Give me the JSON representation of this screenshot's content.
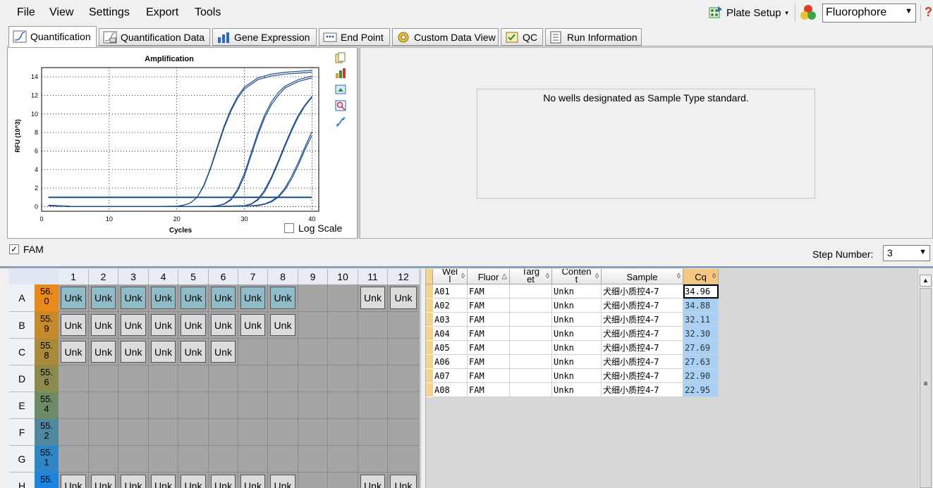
{
  "menu": [
    "File",
    "View",
    "Settings",
    "Export",
    "Tools"
  ],
  "toolbar": {
    "plate_setup": "Plate Setup",
    "fluorophore": "Fluorophore",
    "help": "?"
  },
  "tabs": [
    "Quantification",
    "Quantification Data",
    "Gene Expression",
    "End Point",
    "Custom Data View",
    "QC",
    "Run Information"
  ],
  "chart": {
    "log_scale_label": "Log Scale"
  },
  "chart_data": {
    "type": "line",
    "title": "Amplification",
    "xlabel": "Cycles",
    "ylabel": "RFU (10^3)",
    "xlim": [
      0,
      41
    ],
    "ylim": [
      -0.5,
      15
    ],
    "xticks": [
      0,
      10,
      20,
      30,
      40
    ],
    "yticks": [
      0,
      2,
      4,
      6,
      8,
      10,
      12,
      14
    ],
    "grid": true,
    "threshold": 1.0,
    "series": [
      {
        "x": [
          1,
          5,
          10,
          15,
          20,
          21,
          22,
          23,
          24,
          25,
          26,
          27,
          28,
          29,
          30,
          32,
          34,
          36,
          38,
          40
        ],
        "values": [
          0.1,
          0.0,
          0.0,
          0.0,
          0.05,
          0.15,
          0.4,
          1.0,
          2.3,
          4.2,
          6.5,
          8.7,
          10.5,
          11.9,
          12.9,
          13.9,
          14.3,
          14.5,
          14.6,
          14.7
        ]
      },
      {
        "x": [
          1,
          5,
          10,
          15,
          20,
          21,
          22,
          23,
          24,
          25,
          26,
          27,
          28,
          29,
          30,
          32,
          34,
          36,
          38,
          40
        ],
        "values": [
          0.15,
          0.0,
          0.0,
          0.0,
          0.05,
          0.15,
          0.4,
          1.0,
          2.2,
          4.1,
          6.3,
          8.5,
          10.3,
          11.7,
          12.7,
          13.7,
          14.1,
          14.3,
          14.4,
          14.5
        ]
      },
      {
        "x": [
          1,
          5,
          10,
          15,
          20,
          25,
          26,
          27,
          28,
          29,
          30,
          31,
          32,
          33,
          34,
          35,
          36,
          38,
          40
        ],
        "values": [
          0.1,
          0.0,
          0.0,
          0.0,
          0.0,
          0.05,
          0.1,
          0.3,
          0.8,
          1.9,
          3.6,
          5.8,
          8.0,
          9.9,
          11.3,
          12.3,
          13.0,
          13.7,
          14.1
        ]
      },
      {
        "x": [
          1,
          5,
          10,
          15,
          20,
          25,
          26,
          27,
          28,
          29,
          30,
          31,
          32,
          33,
          34,
          35,
          36,
          38,
          40
        ],
        "values": [
          0.1,
          0.0,
          0.0,
          0.0,
          0.0,
          0.05,
          0.1,
          0.25,
          0.7,
          1.7,
          3.3,
          5.5,
          7.7,
          9.6,
          11.0,
          12.0,
          12.8,
          13.5,
          13.9
        ]
      },
      {
        "x": [
          1,
          5,
          10,
          15,
          20,
          25,
          30,
          31,
          32,
          33,
          34,
          35,
          36,
          37,
          38,
          39,
          40
        ],
        "values": [
          0.1,
          0.0,
          0.0,
          0.0,
          0.0,
          0.0,
          0.1,
          0.3,
          0.8,
          1.8,
          3.2,
          4.9,
          6.7,
          8.4,
          9.9,
          11.0,
          11.9
        ]
      },
      {
        "x": [
          1,
          5,
          10,
          15,
          20,
          25,
          30,
          31,
          32,
          33,
          34,
          35,
          36,
          37,
          38,
          39,
          40
        ],
        "values": [
          0.1,
          0.0,
          0.0,
          0.0,
          0.0,
          0.0,
          0.1,
          0.25,
          0.7,
          1.6,
          3.0,
          4.7,
          6.5,
          8.2,
          9.7,
          10.9,
          11.8
        ]
      },
      {
        "x": [
          1,
          5,
          10,
          15,
          20,
          25,
          30,
          32,
          33,
          34,
          35,
          36,
          37,
          38,
          39,
          40
        ],
        "values": [
          0.1,
          0.0,
          0.0,
          0.0,
          0.0,
          0.0,
          0.05,
          0.15,
          0.3,
          0.6,
          1.1,
          2.0,
          3.3,
          4.8,
          6.5,
          8.1
        ]
      },
      {
        "x": [
          1,
          5,
          10,
          15,
          20,
          25,
          30,
          32,
          33,
          34,
          35,
          36,
          37,
          38,
          39,
          40
        ],
        "values": [
          0.1,
          0.0,
          0.0,
          0.0,
          0.0,
          0.0,
          0.05,
          0.1,
          0.25,
          0.5,
          1.0,
          1.8,
          3.0,
          4.5,
          6.2,
          7.7
        ]
      }
    ]
  },
  "std_panel": {
    "message": "No wells designated as Sample Type standard."
  },
  "filter": {
    "fam_label": "FAM",
    "step_label": "Step Number:",
    "step_value": "3"
  },
  "plate": {
    "columns": [
      "1",
      "2",
      "3",
      "4",
      "5",
      "6",
      "7",
      "8",
      "9",
      "10",
      "11",
      "12"
    ],
    "rows": [
      {
        "label": "A",
        "temp_top": "56.",
        "temp_bot": "0",
        "temp_color": "#e8891a",
        "wells": [
          "Unk",
          "Unk",
          "Unk",
          "Unk",
          "Unk",
          "Unk",
          "Unk",
          "Unk",
          "",
          "",
          "Unk",
          "Unk"
        ],
        "selected": [
          true,
          true,
          true,
          true,
          true,
          true,
          true,
          true,
          false,
          false,
          false,
          false
        ]
      },
      {
        "label": "B",
        "temp_top": "55.",
        "temp_bot": "9",
        "temp_color": "#c8892a",
        "wells": [
          "Unk",
          "Unk",
          "Unk",
          "Unk",
          "Unk",
          "Unk",
          "Unk",
          "Unk",
          "",
          "",
          "",
          ""
        ],
        "selected": [
          false,
          false,
          false,
          false,
          false,
          false,
          false,
          false,
          false,
          false,
          false,
          false
        ]
      },
      {
        "label": "C",
        "temp_top": "55.",
        "temp_bot": "8",
        "temp_color": "#a88a3a",
        "wells": [
          "Unk",
          "Unk",
          "Unk",
          "Unk",
          "Unk",
          "Unk",
          "",
          "",
          "",
          "",
          "",
          ""
        ],
        "selected": [
          false,
          false,
          false,
          false,
          false,
          false,
          false,
          false,
          false,
          false,
          false,
          false
        ]
      },
      {
        "label": "D",
        "temp_top": "55.",
        "temp_bot": "6",
        "temp_color": "#8c8a4e",
        "wells": [
          "",
          "",
          "",
          "",
          "",
          "",
          "",
          "",
          "",
          "",
          "",
          ""
        ],
        "selected": [
          false,
          false,
          false,
          false,
          false,
          false,
          false,
          false,
          false,
          false,
          false,
          false
        ]
      },
      {
        "label": "E",
        "temp_top": "55.",
        "temp_bot": "4",
        "temp_color": "#6e8a66",
        "wells": [
          "",
          "",
          "",
          "",
          "",
          "",
          "",
          "",
          "",
          "",
          "",
          ""
        ],
        "selected": [
          false,
          false,
          false,
          false,
          false,
          false,
          false,
          false,
          false,
          false,
          false,
          false
        ]
      },
      {
        "label": "F",
        "temp_top": "55.",
        "temp_bot": "2",
        "temp_color": "#4f88a0",
        "wells": [
          "",
          "",
          "",
          "",
          "",
          "",
          "",
          "",
          "",
          "",
          "",
          ""
        ],
        "selected": [
          false,
          false,
          false,
          false,
          false,
          false,
          false,
          false,
          false,
          false,
          false,
          false
        ]
      },
      {
        "label": "G",
        "temp_top": "55.",
        "temp_bot": "1",
        "temp_color": "#2f86c6",
        "wells": [
          "",
          "",
          "",
          "",
          "",
          "",
          "",
          "",
          "",
          "",
          "",
          ""
        ],
        "selected": [
          false,
          false,
          false,
          false,
          false,
          false,
          false,
          false,
          false,
          false,
          false,
          false
        ]
      },
      {
        "label": "H",
        "temp_top": "55.",
        "temp_bot": "",
        "temp_color": "#1b84e0",
        "wells": [
          "Unk",
          "Unk",
          "Unk",
          "Unk",
          "Unk",
          "Unk",
          "Unk",
          "Unk",
          "",
          "",
          "Unk",
          "Unk"
        ],
        "selected": [
          false,
          false,
          false,
          false,
          false,
          false,
          false,
          false,
          false,
          false,
          false,
          false
        ]
      }
    ]
  },
  "table": {
    "headers": [
      "Wel\nl",
      "Fluor",
      "Targ\net",
      "Conten\nt",
      "Sample",
      "Cq"
    ],
    "rows": [
      [
        "A01",
        "FAM",
        "",
        "Unkn",
        "犬细小质控4-7",
        "34.96"
      ],
      [
        "A02",
        "FAM",
        "",
        "Unkn",
        "犬细小质控4-7",
        "34.88"
      ],
      [
        "A03",
        "FAM",
        "",
        "Unkn",
        "犬细小质控4-7",
        "32.11"
      ],
      [
        "A04",
        "FAM",
        "",
        "Unkn",
        "犬细小质控4-7",
        "32.30"
      ],
      [
        "A05",
        "FAM",
        "",
        "Unkn",
        "犬细小质控4-7",
        "27.69"
      ],
      [
        "A06",
        "FAM",
        "",
        "Unkn",
        "犬细小质控4-7",
        "27.63"
      ],
      [
        "A07",
        "FAM",
        "",
        "Unkn",
        "犬细小质控4-7",
        "22.90"
      ],
      [
        "A08",
        "FAM",
        "",
        "Unkn",
        "犬细小质控4-7",
        "22.95"
      ]
    ]
  }
}
